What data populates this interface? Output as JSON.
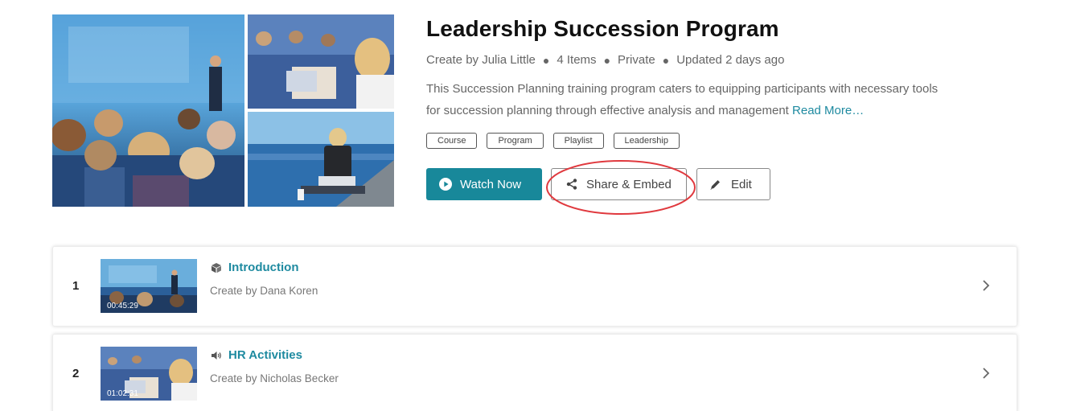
{
  "program": {
    "title": "Leadership Succession Program",
    "meta": {
      "creator": "Create by Julia Little",
      "items": "4 Items",
      "visibility": "Private",
      "updated": "Updated 2 days ago"
    },
    "description": "This Succession Planning training program caters to equipping participants with necessary tools for succession planning through effective analysis and management",
    "read_more": "Read More…",
    "tags": [
      "Course",
      "Program",
      "Playlist",
      "Leadership"
    ]
  },
  "actions": {
    "watch_label": "Watch Now",
    "share_label": "Share & Embed",
    "edit_label": "Edit"
  },
  "items": [
    {
      "number": "1",
      "title": "Introduction",
      "creator": "Create by Dana Koren",
      "duration": "00:45:29",
      "type_icon": "cube-icon"
    },
    {
      "number": "2",
      "title": "HR Activities",
      "creator": "Create by Nicholas Becker",
      "duration": "01:02:31",
      "type_icon": "speaker-icon"
    }
  ],
  "colors": {
    "accent": "#18889a",
    "link": "#1e8aa0",
    "highlight_ring": "#e0393e"
  }
}
